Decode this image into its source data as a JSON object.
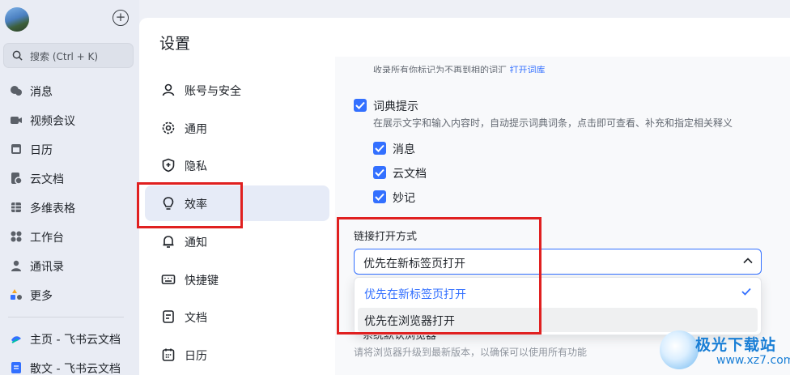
{
  "sidebar": {
    "search_placeholder": "搜索 (Ctrl + K)",
    "items": [
      {
        "label": "消息",
        "icon": "chat-bubble-icon"
      },
      {
        "label": "视频会议",
        "icon": "video-camera-icon"
      },
      {
        "label": "日历",
        "icon": "calendar-icon"
      },
      {
        "label": "云文档",
        "icon": "cloud-doc-icon"
      },
      {
        "label": "多维表格",
        "icon": "table-grid-icon"
      },
      {
        "label": "工作台",
        "icon": "apps-grid-icon"
      },
      {
        "label": "通讯录",
        "icon": "contacts-icon"
      },
      {
        "label": "更多",
        "icon": "more-apps-icon"
      }
    ],
    "docs": [
      {
        "label": "主页 - 飞书云文档",
        "color": "#3370ff"
      },
      {
        "label": "散文 - 飞书云文档",
        "color": "#3370ff"
      }
    ]
  },
  "settings": {
    "title": "设置",
    "menu": [
      {
        "label": "账号与安全",
        "icon": "user-icon"
      },
      {
        "label": "通用",
        "icon": "gear-icon"
      },
      {
        "label": "隐私",
        "icon": "shield-icon"
      },
      {
        "label": "效率",
        "icon": "lightbulb-icon"
      },
      {
        "label": "通知",
        "icon": "bell-icon"
      },
      {
        "label": "快捷键",
        "icon": "keyboard-icon"
      },
      {
        "label": "文档",
        "icon": "document-icon"
      },
      {
        "label": "日历",
        "icon": "calendar-icon"
      }
    ],
    "active_index": 3
  },
  "content": {
    "cut_text": "收录所有你标记为不再到相的词汇",
    "cut_link": "打开词库",
    "dict_hint": {
      "label": "词典提示",
      "desc": "在展示文字和输入内容时，自动提示词典词条，点击即可查看、补充和指定相关释义",
      "checked": true
    },
    "sub_options": [
      {
        "label": "消息",
        "checked": true
      },
      {
        "label": "云文档",
        "checked": true
      },
      {
        "label": "妙记",
        "checked": true
      }
    ],
    "link_open": {
      "label": "链接打开方式",
      "selected": "优先在新标签页打开",
      "options": [
        {
          "label": "优先在新标签页打开",
          "selected": true
        },
        {
          "label": "优先在浏览器打开",
          "selected": false
        }
      ]
    },
    "hidden_under": "系统默认浏览器",
    "footer_note": "请将浏览器升级到最新版本，以确保可以使用所有功能"
  },
  "watermark": {
    "text": "极光下载站",
    "url": "www.xz7.com"
  },
  "colors": {
    "accent": "#3370ff",
    "highlight_box": "#e02020"
  }
}
